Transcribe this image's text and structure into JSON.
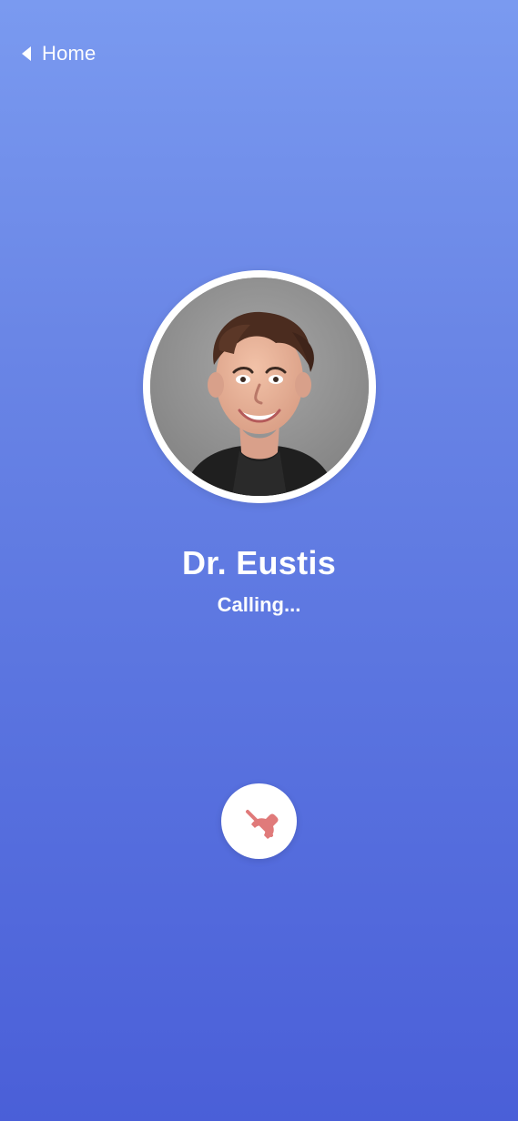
{
  "nav": {
    "back_label": "Home"
  },
  "call": {
    "contact_name": "Dr. Eustis",
    "status": "Calling..."
  },
  "icons": {
    "back": "caret-left-icon",
    "end_call": "phone-hangup-icon"
  },
  "colors": {
    "background_top": "#7a9af0",
    "background_bottom": "#4a5fd8",
    "end_call_icon": "#e07a7a",
    "text": "#ffffff"
  }
}
